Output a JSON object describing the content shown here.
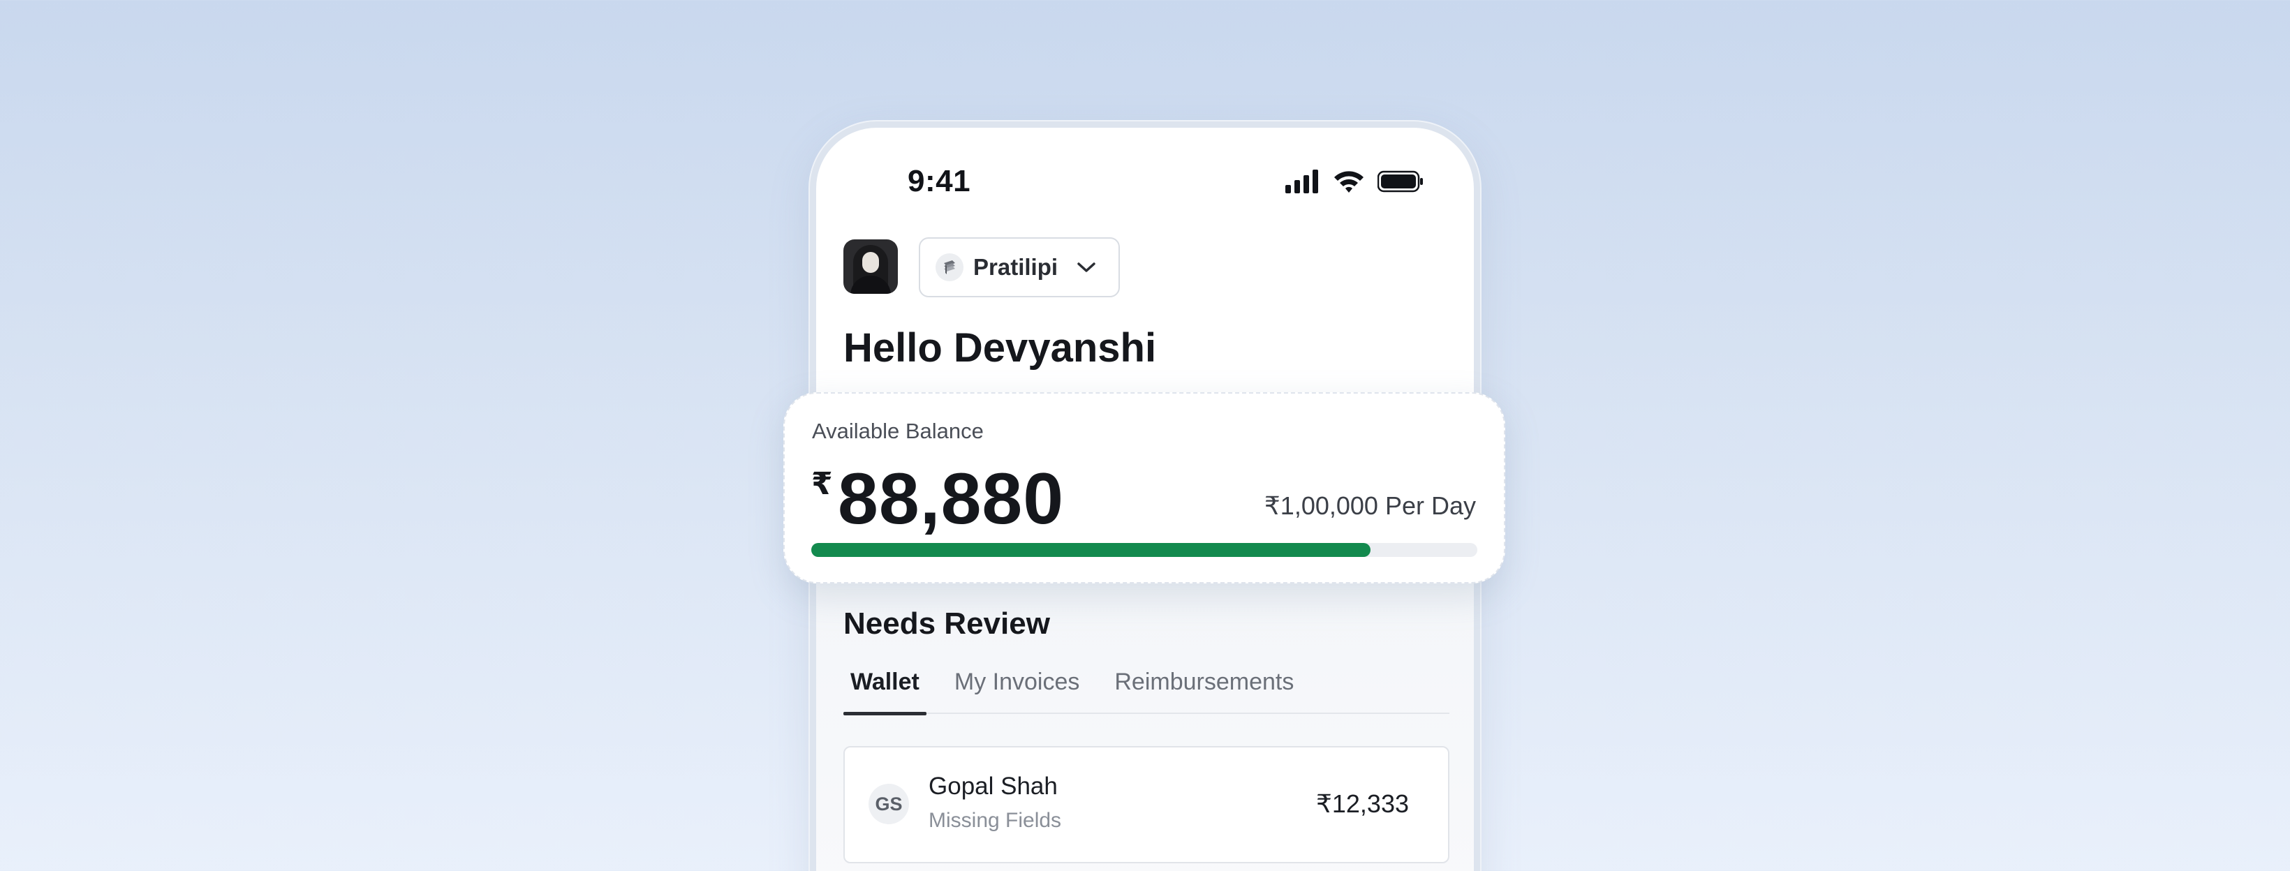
{
  "status_bar": {
    "time": "9:41",
    "icons": [
      "signal-icon",
      "wifi-icon",
      "battery-icon"
    ]
  },
  "header": {
    "avatar": "avatar",
    "organization": "Pratilipi",
    "org_icon": "stack-icon",
    "dropdown_icon": "chevron-down-icon",
    "greeting": "Hello Devyanshi"
  },
  "balance": {
    "label": "Available Balance",
    "currency_symbol": "₹",
    "amount": "88,880",
    "limit": "₹1,00,000 Per Day",
    "progress_fraction": 0.84,
    "progress_color": "#138a4e"
  },
  "review": {
    "title": "Needs Review",
    "tabs": [
      {
        "label": "Wallet",
        "active": true
      },
      {
        "label": "My Invoices",
        "active": false
      },
      {
        "label": "Reimbursements",
        "active": false
      }
    ],
    "items": [
      {
        "initials": "GS",
        "name": "Gopal Shah",
        "status": "Missing Fields",
        "amount": "₹12,333"
      }
    ]
  }
}
